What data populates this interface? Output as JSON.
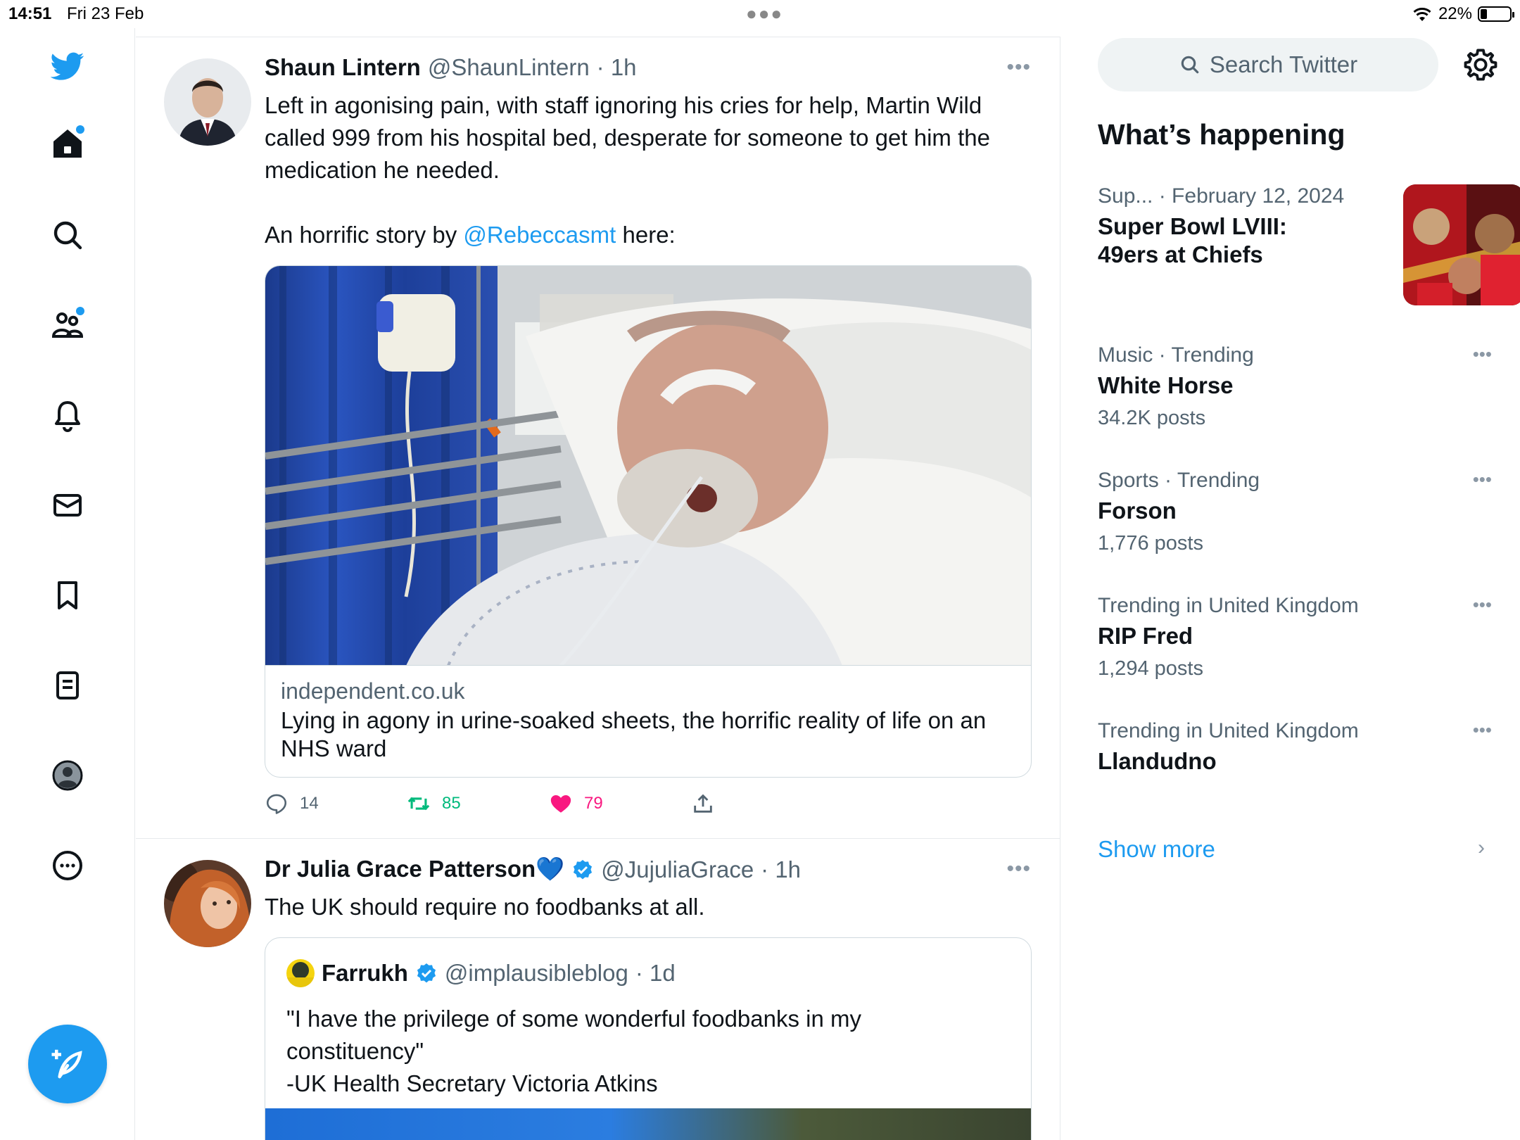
{
  "status_bar": {
    "time": "14:51",
    "date": "Fri 23 Feb",
    "battery": "22%",
    "battery_level": 0.22
  },
  "nav": {
    "items": [
      {
        "name": "twitter-logo-icon"
      },
      {
        "name": "home-icon",
        "dot": true
      },
      {
        "name": "explore-icon"
      },
      {
        "name": "communities-icon",
        "dot": true
      },
      {
        "name": "notifications-icon"
      },
      {
        "name": "messages-icon"
      },
      {
        "name": "bookmarks-icon"
      },
      {
        "name": "lists-icon"
      },
      {
        "name": "profile-icon"
      },
      {
        "name": "more-icon"
      }
    ],
    "compose_icon": "compose-tweet-icon"
  },
  "colors": {
    "accent": "#1d9bf0",
    "text": "#0f1419",
    "secondary": "#536471",
    "retweet": "#00ba7c",
    "like": "#f91880",
    "border": "#cfd9de"
  },
  "timeline": {
    "tweets": [
      {
        "name": "Shaun Lintern",
        "handle": "@ShaunLintern",
        "time": "· 1h",
        "more": "•••",
        "text_lines": [
          "Left in agonising pain, with staff ignoring his cries for help, Martin Wild",
          "called 999 from his hospital bed, desperate for someone to get him the",
          "medication he needed."
        ],
        "text_pre_mention": "An horrific story by ",
        "mention": "@Rebeccasmt",
        "text_post_mention": " here:",
        "card": {
          "domain": "independent.co.uk",
          "title": "Lying in agony in urine-soaked sheets, the horrific reality of life on an NHS ward"
        },
        "actions": {
          "replies": "14",
          "retweets": "85",
          "likes": "79"
        }
      },
      {
        "name": "Dr Julia Grace Patterson💙",
        "handle": "@JujuliaGrace",
        "time": "· 1h",
        "more": "•••",
        "text": "The UK should require no foodbanks at all.",
        "quote": {
          "name": "Farrukh",
          "handle": "@implausibleblog",
          "time": "· 1d",
          "lines": [
            "\"I have the privilege of some wonderful foodbanks in my",
            "constituency\"",
            "-UK Health Secretary Victoria Atkins"
          ]
        }
      }
    ]
  },
  "sidebar": {
    "search_placeholder": "Search Twitter",
    "heading": "What’s happening",
    "trends": [
      {
        "meta_a": "Sup...",
        "meta_b": "· February 12, 2024",
        "title_lines": [
          "Super Bowl LVIII:",
          "49ers at Chiefs"
        ],
        "count": "",
        "has_image": true
      },
      {
        "meta": "Music · Trending",
        "title": "White Horse",
        "count": "34.2K posts"
      },
      {
        "meta": "Sports · Trending",
        "title": "Forson",
        "count": "1,776 posts"
      },
      {
        "meta": "Trending in United Kingdom",
        "title": "RIP Fred",
        "count": "1,294 posts"
      },
      {
        "meta": "Trending in United Kingdom",
        "title": "Llandudno",
        "count": ""
      }
    ],
    "trend_more": "•••",
    "show_more": "Show more",
    "show_more_chevron": "›"
  }
}
